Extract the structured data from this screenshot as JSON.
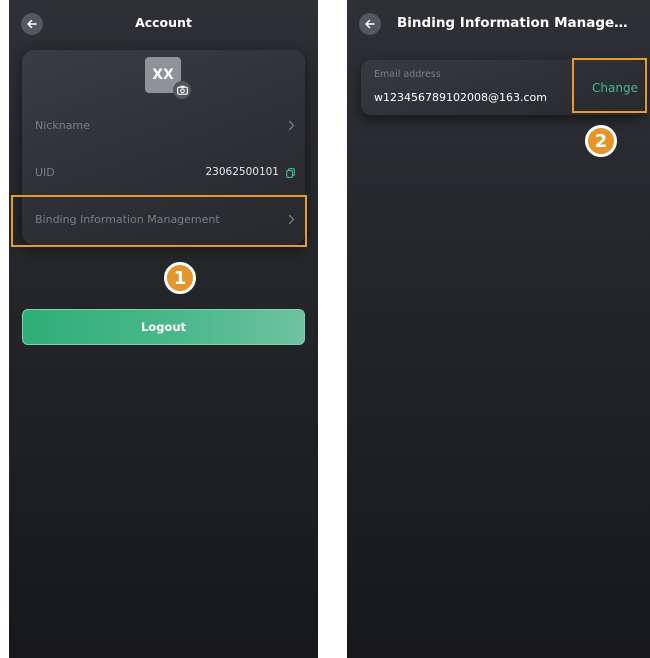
{
  "screen1": {
    "title": "Account",
    "avatar_initials": "XX",
    "rows": [
      {
        "label": "Nickname"
      },
      {
        "label": "UID",
        "value": "23062500101"
      },
      {
        "label": "Binding Information Management"
      }
    ],
    "step_number": "1",
    "logout_label": "Logout"
  },
  "screen2": {
    "title": "Binding Information Manageme...",
    "email_label": "Email address",
    "email_value": "w123456789102008@163.com",
    "change_label": "Change",
    "step_number": "2"
  },
  "colors": {
    "accent_green": "#3fb98a",
    "highlight_orange": "#e69b2f"
  },
  "icons": [
    "back-arrow-icon",
    "camera-icon",
    "chevron-right-icon",
    "copy-icon"
  ]
}
